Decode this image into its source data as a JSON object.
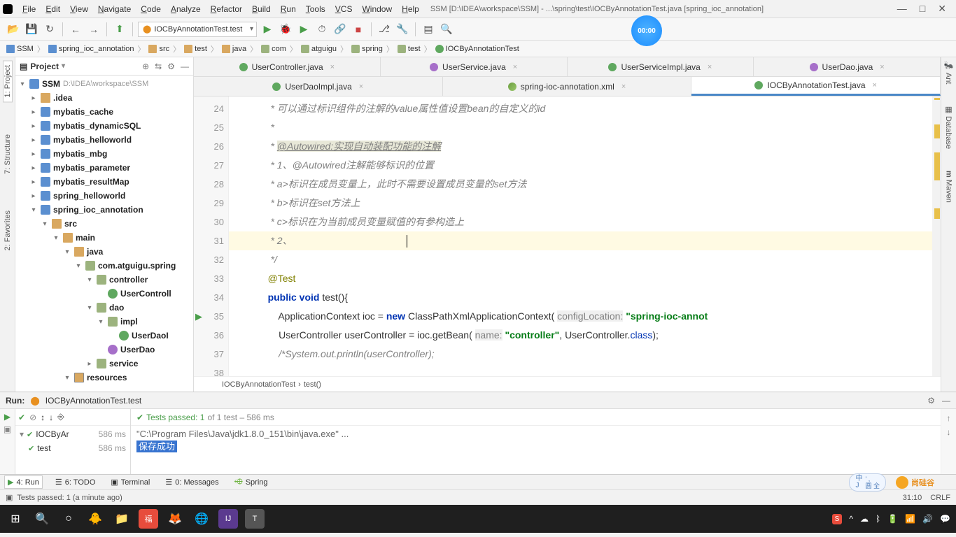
{
  "window": {
    "title": "SSM [D:\\IDEA\\workspace\\SSM] - ...\\spring\\test\\IOCByAnnotationTest.java [spring_ioc_annotation]"
  },
  "menu": [
    "File",
    "Edit",
    "View",
    "Navigate",
    "Code",
    "Analyze",
    "Refactor",
    "Build",
    "Run",
    "Tools",
    "VCS",
    "Window",
    "Help"
  ],
  "toolbar": {
    "runconfig": "IOCByAnnotationTest.test",
    "timer": "00:00"
  },
  "breadcrumb": [
    "SSM",
    "spring_ioc_annotation",
    "src",
    "test",
    "java",
    "com",
    "atguigu",
    "spring",
    "test",
    "IOCByAnnotationTest"
  ],
  "project": {
    "header": "Project",
    "root": {
      "name": "SSM",
      "path": "D:\\IDEA\\workspace\\SSM"
    },
    "nodes": [
      {
        "l": 1,
        "ic": "fold",
        "n": ".idea",
        "exp": ">"
      },
      {
        "l": 1,
        "ic": "mod",
        "n": "mybatis_cache",
        "exp": ">"
      },
      {
        "l": 1,
        "ic": "mod",
        "n": "mybatis_dynamicSQL",
        "exp": ">"
      },
      {
        "l": 1,
        "ic": "mod",
        "n": "mybatis_helloworld",
        "exp": ">"
      },
      {
        "l": 1,
        "ic": "mod",
        "n": "mybatis_mbg",
        "exp": ">"
      },
      {
        "l": 1,
        "ic": "mod",
        "n": "mybatis_parameter",
        "exp": ">"
      },
      {
        "l": 1,
        "ic": "mod",
        "n": "mybatis_resultMap",
        "exp": ">"
      },
      {
        "l": 1,
        "ic": "mod",
        "n": "spring_helloworld",
        "exp": ">"
      },
      {
        "l": 1,
        "ic": "mod",
        "n": "spring_ioc_annotation",
        "exp": "v"
      },
      {
        "l": 2,
        "ic": "fold",
        "n": "src",
        "exp": "v"
      },
      {
        "l": 3,
        "ic": "fold",
        "n": "main",
        "exp": "v"
      },
      {
        "l": 4,
        "ic": "fold",
        "n": "java",
        "exp": "v"
      },
      {
        "l": 5,
        "ic": "pkg",
        "n": "com.atguigu.spring",
        "exp": "v"
      },
      {
        "l": 6,
        "ic": "pkg",
        "n": "controller",
        "exp": "v"
      },
      {
        "l": 7,
        "ic": "cls",
        "n": "UserControll",
        "exp": ""
      },
      {
        "l": 6,
        "ic": "pkg",
        "n": "dao",
        "exp": "v"
      },
      {
        "l": 7,
        "ic": "pkg",
        "n": "impl",
        "exp": "v"
      },
      {
        "l": 8,
        "ic": "cls",
        "n": "UserDaoI",
        "exp": ""
      },
      {
        "l": 7,
        "ic": "int",
        "n": "UserDao",
        "exp": ""
      },
      {
        "l": 6,
        "ic": "pkg",
        "n": "service",
        "exp": ">"
      },
      {
        "l": 4,
        "ic": "res",
        "n": "resources",
        "exp": "v"
      }
    ]
  },
  "tabs": {
    "row1": [
      {
        "ic": "cls",
        "label": "UserController.java"
      },
      {
        "ic": "int",
        "label": "UserService.java"
      },
      {
        "ic": "cls",
        "label": "UserServiceImpl.java"
      },
      {
        "ic": "int",
        "label": "UserDao.java"
      }
    ],
    "row2": [
      {
        "ic": "cls",
        "label": "UserDaoImpl.java",
        "active": false
      },
      {
        "ic": "xml",
        "label": "spring-ioc-annotation.xml",
        "active": false
      },
      {
        "ic": "test",
        "label": "IOCByAnnotationTest.java",
        "active": true
      }
    ]
  },
  "code": {
    "startLine": 24,
    "lines": [
      {
        "n": 24,
        "t": "     * 可以通过标识组件的注解的value属性值设置bean的自定义的id",
        "cls": "c-comment"
      },
      {
        "n": 25,
        "t": "     *",
        "cls": "c-comment"
      },
      {
        "n": 26,
        "t": "     * ",
        "cls": "c-comment",
        "link": "@Autowired:实现自动装配功能的注解"
      },
      {
        "n": 27,
        "t": "     * 1、@Autowired注解能够标识的位置",
        "cls": "c-comment"
      },
      {
        "n": 28,
        "t": "     * a>标识在成员变量上，此时不需要设置成员变量的set方法",
        "cls": "c-comment"
      },
      {
        "n": 29,
        "t": "     * b>标识在set方法上",
        "cls": "c-comment"
      },
      {
        "n": 30,
        "t": "     * c>标识在为当前成员变量赋值的有参构造上",
        "cls": "c-comment"
      },
      {
        "n": 31,
        "t": "     * 2、",
        "cls": "c-comment",
        "hl": true,
        "cursor": true
      },
      {
        "n": 32,
        "t": "     */",
        "cls": "c-comment"
      },
      {
        "n": 33,
        "t": "",
        "cls": ""
      },
      {
        "n": 34,
        "raw": "    <span class='c-anno'>@Test</span>"
      },
      {
        "n": 35,
        "raw": "    <span class='c-kw'>public void</span> test(){",
        "run": true
      },
      {
        "n": 36,
        "raw": "        ApplicationContext ioc = <span class='c-kw'>new</span> ClassPathXmlApplicationContext( <span class='c-param'>configLocation:</span> <span class='c-str'>\"spring-ioc-annot</span>"
      },
      {
        "n": 37,
        "raw": "        UserController userController = ioc.getBean( <span class='c-param'>name:</span> <span class='c-str'>\"controller\"</span>, UserController.<span class='c-kw2'>class</span>);"
      },
      {
        "n": 38,
        "raw": "        <span class='c-comment'>/*System.out.println(userController);</span>"
      }
    ],
    "breadcrumb": [
      "IOCByAnnotationTest",
      "test()"
    ]
  },
  "run": {
    "title": "Run:",
    "config": "IOCByAnnotationTest.test",
    "passed": "Tests passed: 1",
    "passedOf": "of 1 test – 586 ms",
    "tree": [
      {
        "name": "IOCByAr",
        "time": "586 ms"
      },
      {
        "name": "test",
        "time": "586 ms"
      }
    ],
    "console": {
      "cmd": "\"C:\\Program Files\\Java\\jdk1.8.0_151\\bin\\java.exe\" ...",
      "out": "保存成功"
    }
  },
  "bottomtabs": [
    "4: Run",
    "6: TODO",
    "Terminal",
    "0: Messages",
    "Spring"
  ],
  "status": {
    "left": "Tests passed: 1 (a minute ago)",
    "pos": "31:10",
    "enc": "CRLF"
  },
  "lang": {
    "top": "中",
    "bot": "J",
    "r1": "' ,",
    "r2": "圆 全"
  },
  "brand": "尚硅谷"
}
